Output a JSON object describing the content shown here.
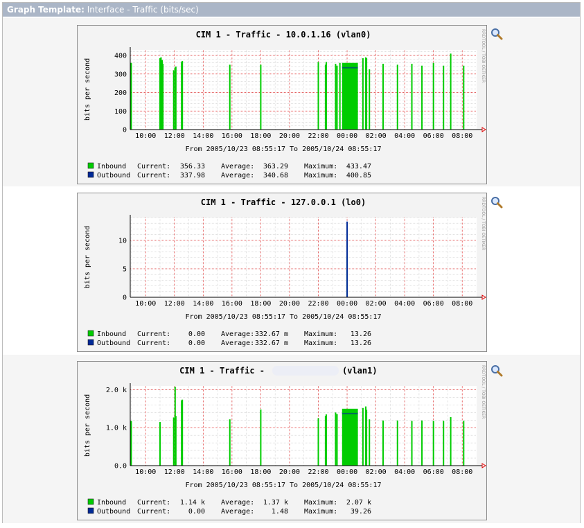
{
  "header": {
    "label": "Graph Template:",
    "value": "Interface - Traffic (bits/sec)"
  },
  "colors": {
    "inbound": "#00cc00",
    "outbound": "#002a97",
    "grid": "#e23030",
    "header_bar": "#abb6c7"
  },
  "icons": {
    "zoom": "magnifier-icon"
  },
  "chart_data": [
    {
      "type": "area",
      "title": "CIM 1 - Traffic - 10.0.1.16 (vlan0)",
      "ylabel": "bits per second",
      "side_label": "RRDTOOL / TOBI OETIKER",
      "ylim": [
        0,
        430
      ],
      "yticks": [
        0,
        100,
        200,
        300,
        400
      ],
      "ytick_labels": [
        "0",
        "100",
        "200",
        "300",
        "400"
      ],
      "xlim_hours": [
        8.93,
        33.0
      ],
      "xticks": [
        "10:00",
        "12:00",
        "14:00",
        "16:00",
        "18:00",
        "20:00",
        "22:00",
        "00:00",
        "02:00",
        "04:00",
        "06:00",
        "08:00"
      ],
      "footer": "From 2005/10/23 08:55:17 To 2005/10/24 08:55:17",
      "spikes_x_hours": [
        9.0,
        11.0,
        11.07,
        11.15,
        11.2,
        11.95,
        12.05,
        12.1,
        12.5,
        12.55,
        15.85,
        18.0,
        22.0,
        22.5,
        22.55,
        23.2,
        23.3,
        23.5,
        25.1,
        25.3,
        25.35,
        25.55,
        26.5,
        27.5,
        28.5,
        29.2,
        30.0,
        30.7,
        31.2,
        32.1
      ],
      "spikes_y": [
        360,
        385,
        390,
        375,
        355,
        320,
        335,
        340,
        365,
        370,
        350,
        350,
        365,
        350,
        365,
        355,
        345,
        360,
        385,
        390,
        385,
        325,
        355,
        350,
        355,
        345,
        360,
        345,
        410,
        345
      ],
      "block_x_hours": [
        23.65,
        24.75
      ],
      "block_y": 360,
      "inbound_series": {
        "name": "Inbound",
        "current": "356.33",
        "average": "363.29",
        "maximum": "433.47"
      },
      "outbound_series": {
        "name": "Outbound",
        "current": "337.98",
        "average": "340.68",
        "maximum": "400.85"
      }
    },
    {
      "type": "area",
      "title": "CIM 1 - Traffic - 127.0.0.1 (lo0)",
      "ylabel": "bits per second",
      "side_label": "RRDTOOL / TOBI OETIKER",
      "ylim": [
        0,
        14
      ],
      "yticks": [
        0,
        5,
        10
      ],
      "ytick_labels": [
        "0",
        "5",
        "10"
      ],
      "xlim_hours": [
        8.93,
        33.0
      ],
      "xticks": [
        "10:00",
        "12:00",
        "14:00",
        "16:00",
        "18:00",
        "20:00",
        "22:00",
        "00:00",
        "02:00",
        "04:00",
        "06:00",
        "08:00"
      ],
      "footer": "From 2005/10/23 08:55:17 To 2005/10/24 08:55:17",
      "spikes_x_hours": [
        24.0
      ],
      "spikes_y": [
        7.2
      ],
      "outbound_spike_x_hours": 24.0,
      "outbound_spike_y": 13.3,
      "inbound_series": {
        "name": "Inbound",
        "current": "0.00",
        "average": "332.67 m",
        "maximum": "13.26"
      },
      "outbound_series": {
        "name": "Outbound",
        "current": "0.00",
        "average": "332.67 m",
        "maximum": "13.26"
      }
    },
    {
      "type": "area",
      "title_left": "CIM 1 - Traffic - ",
      "title_right": "(vlan1)",
      "ylabel": "bits per second",
      "side_label": "RRDTOOL / TOBI OETIKER",
      "ylim": [
        0,
        2100
      ],
      "yticks": [
        0,
        1000,
        2000
      ],
      "ytick_labels": [
        "0.0",
        "1.0 k",
        "2.0 k"
      ],
      "xlim_hours": [
        8.93,
        33.0
      ],
      "xticks": [
        "10:00",
        "12:00",
        "14:00",
        "16:00",
        "18:00",
        "20:00",
        "22:00",
        "00:00",
        "02:00",
        "04:00",
        "06:00",
        "08:00"
      ],
      "footer": "From 2005/10/23 08:55:17 To 2005/10/24 08:55:17",
      "spikes_x_hours": [
        9.0,
        11.0,
        11.95,
        12.05,
        12.1,
        12.5,
        12.55,
        15.85,
        18.0,
        22.0,
        22.5,
        22.55,
        23.2,
        23.3,
        25.1,
        25.3,
        25.35,
        25.55,
        26.5,
        27.5,
        28.5,
        29.2,
        30.0,
        30.7,
        31.2,
        32.1
      ],
      "spikes_y": [
        1180,
        1150,
        1270,
        2080,
        1310,
        1720,
        1740,
        1220,
        1480,
        1250,
        1310,
        1350,
        1400,
        1360,
        1520,
        1560,
        1470,
        1220,
        1190,
        1190,
        1180,
        1190,
        1180,
        1180,
        1280,
        1180
      ],
      "block_x_hours": [
        23.65,
        24.75
      ],
      "block_y": 1500,
      "inbound_series": {
        "name": "Inbound",
        "current": "1.14 k",
        "average": "1.37 k",
        "maximum": "2.07 k"
      },
      "outbound_series": {
        "name": "Outbound",
        "current": "0.00",
        "average": "1.48",
        "maximum": "39.26"
      }
    }
  ]
}
